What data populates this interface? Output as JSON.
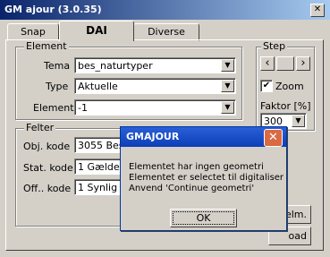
{
  "window": {
    "title": "GM ajour (3.0.35)",
    "close_glyph": "✕"
  },
  "tabs": [
    {
      "label": "Snap"
    },
    {
      "label": "DAI"
    },
    {
      "label": "Diverse"
    }
  ],
  "element_group": {
    "legend": "Element",
    "tema_label": "Tema",
    "tema_value": "bes_naturtyper",
    "type_label": "Type",
    "type_value": "Aktuelle",
    "element_label": "Element",
    "element_value": "-1"
  },
  "step_group": {
    "legend": "Step",
    "prev_glyph": "‹",
    "next_glyph": "›",
    "zoom_label": "Zoom",
    "zoom_checked": true,
    "faktor_label": "Faktor [%]",
    "faktor_value": "300"
  },
  "felter_group": {
    "legend": "Felter",
    "obj_kode_label": "Obj. kode",
    "obj_kode_value": "3055 Bes",
    "stat_kode_label": "Stat. kode",
    "stat_kode_value": "1 Gælden",
    "off_kode_label": "Off.. kode",
    "off_kode_value": "1 Synlig fo"
  },
  "side_buttons": {
    "elm_label": "elm.",
    "load_label": "oad"
  },
  "dialog": {
    "title": "GMAJOUR",
    "close_glyph": "✕",
    "line1": "Elementet har ingen geometri",
    "line2": "Elementet er selectet til digitaliser",
    "line3": "Anvend 'Continue geometri'",
    "ok_label": "OK"
  }
}
